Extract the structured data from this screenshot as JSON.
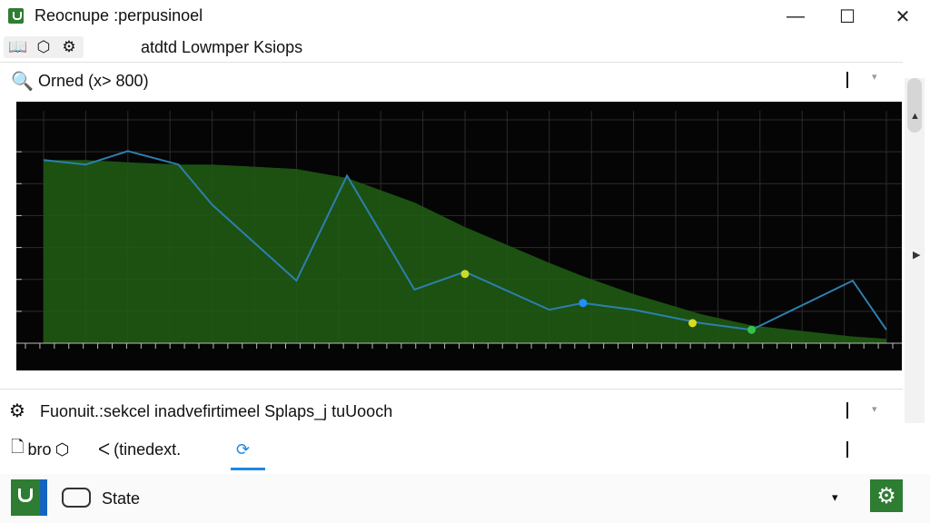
{
  "window": {
    "title": "Reocnupe :perpusinoel",
    "icon": "app-shield-icon",
    "controls": {
      "minimize": "—",
      "maximize": "☐",
      "close": "✕"
    }
  },
  "toolbar": {
    "icons": [
      "book-icon",
      "cube-icon",
      "settings-face-icon"
    ],
    "label": "atdtd Lowmper Ksiops"
  },
  "filter": {
    "icon": "search-icon",
    "text": "Orned (x> 800)",
    "dropdown_symbol": "▾"
  },
  "chart_data": {
    "type": "area",
    "title": "",
    "xlabel": "",
    "ylabel": "",
    "x": [
      0,
      0.05,
      0.1,
      0.16,
      0.2,
      0.3,
      0.36,
      0.44,
      0.5,
      0.6,
      0.64,
      0.7,
      0.78,
      0.84,
      0.96,
      1.0
    ],
    "series": [
      {
        "values": [
          0.82,
          0.82,
          0.81,
          0.8,
          0.8,
          0.78,
          0.74,
          0.63,
          0.52,
          0.36,
          0.3,
          0.22,
          0.13,
          0.08,
          0.03,
          0.02
        ]
      },
      {
        "values": [
          0.82,
          0.8,
          0.86,
          0.8,
          0.62,
          0.28,
          0.75,
          0.24,
          0.32,
          0.15,
          0.18,
          0.15,
          0.09,
          0.06,
          0.28,
          0.06
        ]
      }
    ],
    "colors": {
      "area": "#1f5a14",
      "line": "#2d7fb0",
      "background": "#050505",
      "grid": "#2c2c2c"
    },
    "markers": [
      {
        "x": 0.5,
        "y": 0.31,
        "color": "#c8dc28"
      },
      {
        "x": 0.64,
        "y": 0.18,
        "color": "#1e90ff"
      },
      {
        "x": 0.77,
        "y": 0.09,
        "color": "#d8dc20"
      },
      {
        "x": 0.84,
        "y": 0.06,
        "color": "#34c24e"
      }
    ],
    "grid": true,
    "legend": "none"
  },
  "section2": {
    "icon": "puzzle-icon",
    "text": "Fuonuit.:sekcel inadvefirtimeel Splaps_j tuUooch",
    "dropdown_symbol": "▾"
  },
  "tabs": [
    {
      "icon": "document-icon",
      "label": "bro"
    },
    {
      "icon": "cube-icon",
      "label": ""
    },
    {
      "icon": "chevron-left-icon",
      "label": "(tinedext."
    },
    {
      "icon": "sync-icon",
      "label": ""
    }
  ],
  "status": {
    "logo": "app-logo-icon",
    "shape": "rounded-rect-icon",
    "label": "State",
    "chevron": "▾",
    "settings": "gear-icon"
  }
}
